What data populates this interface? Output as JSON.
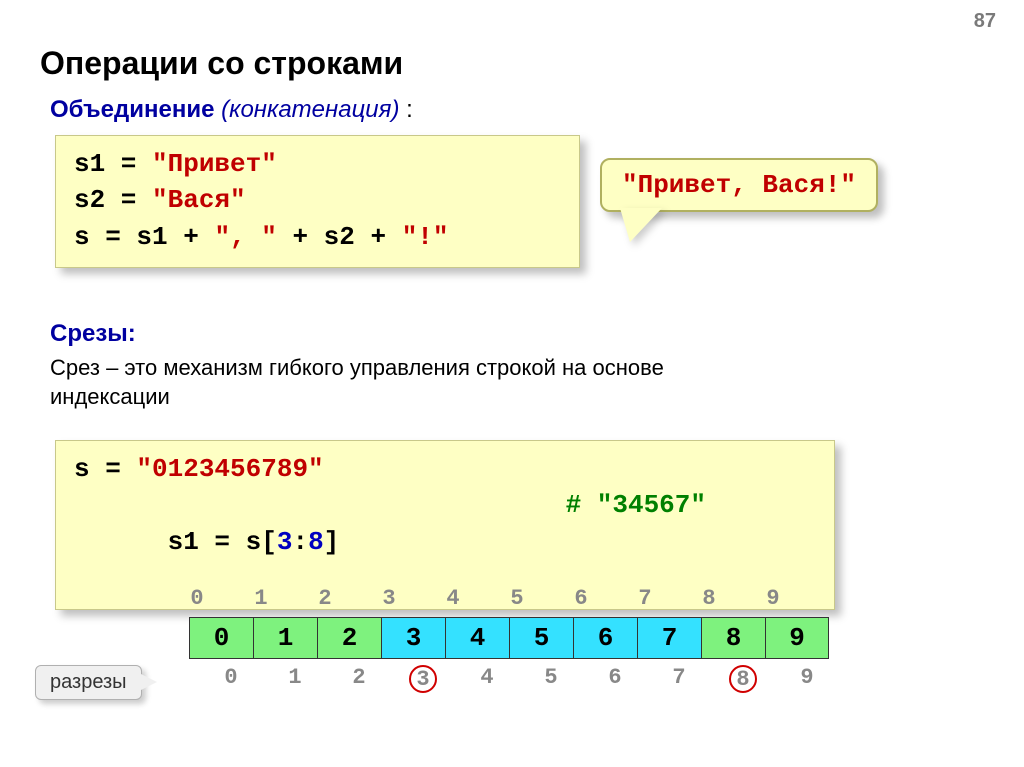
{
  "page_number": "87",
  "title": "Операции со строками",
  "section1": {
    "label_bold": "Объединение",
    "label_italic": "(конкатенация)",
    "colon": " :"
  },
  "code1": {
    "l1a": "s1 = ",
    "l1b": "\"Привет\"",
    "l2a": "s2 = ",
    "l2b": "\"Вася\"",
    "l3a": "s  = s1 + ",
    "l3b": "\", \"",
    "l3c": " + s2 + ",
    "l3d": "\"!\""
  },
  "callout": "\"Привет, Вася!\"",
  "section2": {
    "label": "Срезы:",
    "desc": "Срез – это механизм гибкого управления строкой на основе индексации"
  },
  "code2": {
    "l1a": "s = ",
    "l1b": "\"0123456789\"",
    "l2a": "s1 = s[",
    "l2b": "3",
    "l2c": ":",
    "l2d": "8",
    "l2e": "]",
    "l2_comment": "# \"34567\""
  },
  "idx_top": [
    "0",
    "1",
    "2",
    "3",
    "4",
    "5",
    "6",
    "7",
    "8",
    "9"
  ],
  "cells": [
    "0",
    "1",
    "2",
    "3",
    "4",
    "5",
    "6",
    "7",
    "8",
    "9"
  ],
  "idx_bot": [
    "0",
    "1",
    "2",
    "3",
    "4",
    "5",
    "6",
    "7",
    "8",
    "9"
  ],
  "cuts_label": "разрезы"
}
